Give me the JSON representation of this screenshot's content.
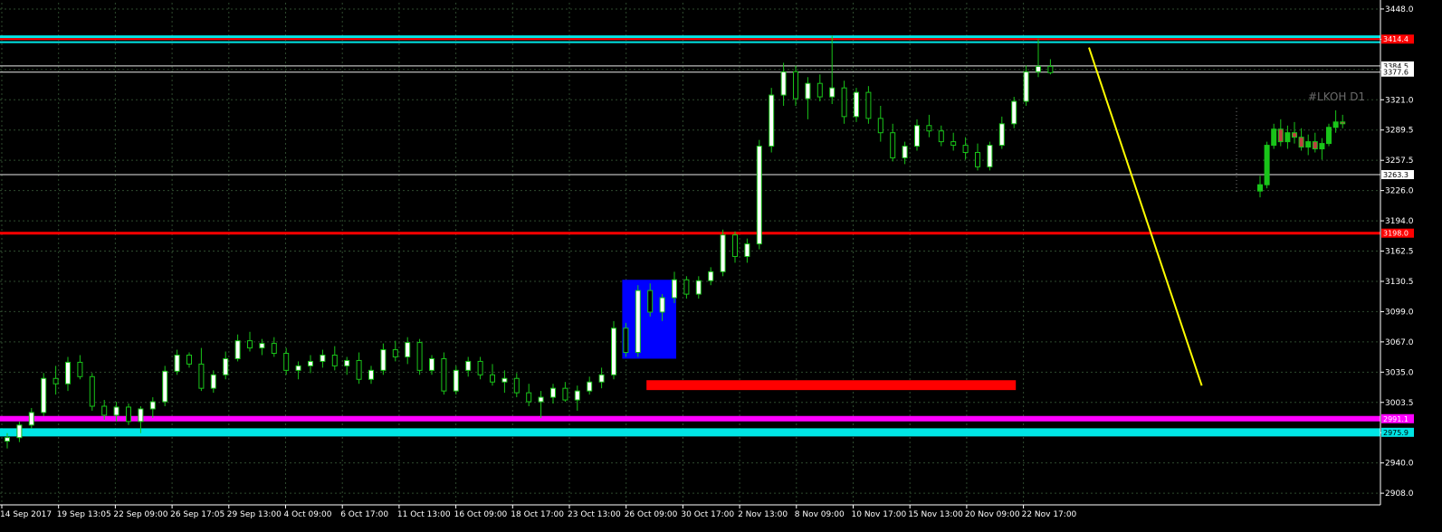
{
  "window": {
    "symbol_title": "#LKOH D1"
  },
  "colors": {
    "background": "#000000",
    "grid": "#2e4a2e",
    "axis": "#ffffff",
    "bull": "#ffffff",
    "bear": "#000000",
    "wick": "#19c419",
    "red": "#ff0000",
    "cyan": "#00e5e5",
    "magenta": "#ff00ff",
    "blue": "#0000ff",
    "yellow": "#ffff00",
    "white_line": "#e8e8e8",
    "mini_bull": "#19c419",
    "mini_bear": "#c04040"
  },
  "chart_data": {
    "type": "candlestick",
    "title": "#LKOH D1",
    "ylim": [
      2895.0,
      3455.0
    ],
    "y_ticks": [
      "3448.0",
      "3385.0",
      "3353.0",
      "3321.0",
      "3289.5",
      "3257.5",
      "3226.0",
      "3194.0",
      "3162.5",
      "3130.5",
      "3099.0",
      "3067.0",
      "3035.0",
      "3003.5",
      "2971.5",
      "2940.0",
      "2908.0"
    ],
    "x_ticks": [
      "14 Sep 2017",
      "19 Sep 13:05",
      "22 Sep 09:00",
      "26 Sep 17:05",
      "29 Sep 13:00",
      "4 Oct 09:00",
      "6 Oct 17:00",
      "11 Oct 13:00",
      "16 Oct 09:00",
      "18 Oct 17:00",
      "23 Oct 13:00",
      "26 Oct 09:00",
      "30 Oct 17:00",
      "2 Nov 13:00",
      "8 Nov 09:00",
      "10 Nov 17:00",
      "15 Nov 13:00",
      "20 Nov 09:00",
      "22 Nov 17:00"
    ],
    "price_labels": [
      {
        "value": 3414.4,
        "text": "3414.4",
        "style": "red"
      },
      {
        "value": 3384.5,
        "text": "3384.5",
        "style": "white"
      },
      {
        "value": 3377.6,
        "text": "3377.6",
        "style": "white"
      },
      {
        "value": 3263.3,
        "text": "3263.3",
        "style": "white"
      },
      {
        "value": 3198.0,
        "text": "3198.0",
        "style": "red"
      },
      {
        "value": 2991.1,
        "text": "2991.1",
        "style": "magenta"
      },
      {
        "value": 2975.9,
        "text": "2975.9",
        "style": "cyan"
      }
    ],
    "horizontal_lines": [
      {
        "value": 3417.0,
        "color": "cyan",
        "width": 3
      },
      {
        "value": 3414.4,
        "color": "red",
        "width": 2
      },
      {
        "value": 3411.0,
        "color": "cyan",
        "width": 2
      },
      {
        "value": 3384.5,
        "color": "white_line",
        "width": 1
      },
      {
        "value": 3377.6,
        "color": "white_line",
        "width": 1
      },
      {
        "value": 3263.3,
        "color": "white_line",
        "width": 1
      },
      {
        "value": 3198.0,
        "color": "red",
        "width": 3
      },
      {
        "value": 2991.1,
        "color": "magenta",
        "width": 6
      },
      {
        "value": 2975.9,
        "color": "cyan",
        "width": 9
      }
    ],
    "rectangles": [
      {
        "i0": 51,
        "i1": 55,
        "y0": 3058.0,
        "y1": 3146.0,
        "color": "blue"
      },
      {
        "i0": 53,
        "i1": 83,
        "y0": 3023.0,
        "y1": 3034.0,
        "color": "red"
      }
    ],
    "trendline": {
      "i0": 85,
      "y0": 3405.0,
      "i1": 94,
      "y1": 3028.0,
      "color": "yellow"
    },
    "candles": [
      [
        2966,
        2975,
        2958,
        2970
      ],
      [
        2970,
        2988,
        2965,
        2984
      ],
      [
        2984,
        3003,
        2980,
        2998
      ],
      [
        2998,
        3042,
        2994,
        3036
      ],
      [
        3036,
        3050,
        3018,
        3030
      ],
      [
        3030,
        3060,
        3022,
        3054
      ],
      [
        3054,
        3062,
        3035,
        3038
      ],
      [
        3038,
        3042,
        3000,
        3005
      ],
      [
        3005,
        3012,
        2990,
        2995
      ],
      [
        2995,
        3010,
        2988,
        3004
      ],
      [
        3004,
        3008,
        2984,
        2988
      ],
      [
        2988,
        3005,
        2975,
        3002
      ],
      [
        3002,
        3015,
        2992,
        3010
      ],
      [
        3010,
        3050,
        3005,
        3044
      ],
      [
        3044,
        3068,
        3040,
        3062
      ],
      [
        3062,
        3065,
        3048,
        3052
      ],
      [
        3052,
        3070,
        3022,
        3025
      ],
      [
        3025,
        3045,
        3020,
        3040
      ],
      [
        3040,
        3066,
        3035,
        3058
      ],
      [
        3058,
        3085,
        3055,
        3078
      ],
      [
        3078,
        3088,
        3066,
        3070
      ],
      [
        3070,
        3080,
        3062,
        3075
      ],
      [
        3075,
        3082,
        3060,
        3064
      ],
      [
        3064,
        3070,
        3040,
        3045
      ],
      [
        3045,
        3055,
        3035,
        3050
      ],
      [
        3050,
        3062,
        3042,
        3055
      ],
      [
        3055,
        3068,
        3048,
        3062
      ],
      [
        3062,
        3072,
        3045,
        3050
      ],
      [
        3050,
        3060,
        3040,
        3056
      ],
      [
        3056,
        3065,
        3030,
        3035
      ],
      [
        3035,
        3050,
        3030,
        3045
      ],
      [
        3045,
        3075,
        3040,
        3068
      ],
      [
        3068,
        3078,
        3055,
        3060
      ],
      [
        3060,
        3082,
        3052,
        3076
      ],
      [
        3076,
        3080,
        3040,
        3045
      ],
      [
        3045,
        3062,
        3040,
        3058
      ],
      [
        3058,
        3065,
        3018,
        3022
      ],
      [
        3022,
        3050,
        3018,
        3045
      ],
      [
        3045,
        3060,
        3038,
        3055
      ],
      [
        3055,
        3060,
        3035,
        3040
      ],
      [
        3040,
        3052,
        3028,
        3032
      ],
      [
        3032,
        3045,
        3020,
        3036
      ],
      [
        3036,
        3042,
        3015,
        3020
      ],
      [
        3020,
        3030,
        3005,
        3010
      ],
      [
        3010,
        3022,
        2992,
        3015
      ],
      [
        3015,
        3030,
        3008,
        3025
      ],
      [
        3025,
        3032,
        3010,
        3012
      ],
      [
        3012,
        3028,
        3000,
        3022
      ],
      [
        3022,
        3038,
        3018,
        3032
      ],
      [
        3032,
        3048,
        3025,
        3040
      ],
      [
        3040,
        3100,
        3035,
        3092
      ],
      [
        3092,
        3098,
        3060,
        3065
      ],
      [
        3065,
        3140,
        3060,
        3134
      ],
      [
        3134,
        3142,
        3105,
        3110
      ],
      [
        3110,
        3130,
        3100,
        3126
      ],
      [
        3126,
        3155,
        3120,
        3146
      ],
      [
        3146,
        3150,
        3125,
        3130
      ],
      [
        3130,
        3150,
        3125,
        3145
      ],
      [
        3145,
        3160,
        3140,
        3155
      ],
      [
        3155,
        3202,
        3150,
        3196
      ],
      [
        3196,
        3200,
        3165,
        3172
      ],
      [
        3172,
        3192,
        3165,
        3186
      ],
      [
        3186,
        3302,
        3180,
        3295
      ],
      [
        3295,
        3360,
        3288,
        3352
      ],
      [
        3352,
        3388,
        3340,
        3378
      ],
      [
        3378,
        3385,
        3340,
        3348
      ],
      [
        3348,
        3372,
        3325,
        3365
      ],
      [
        3365,
        3375,
        3345,
        3350
      ],
      [
        3350,
        3418,
        3342,
        3360
      ],
      [
        3360,
        3368,
        3320,
        3328
      ],
      [
        3328,
        3360,
        3322,
        3355
      ],
      [
        3355,
        3362,
        3320,
        3326
      ],
      [
        3326,
        3340,
        3300,
        3310
      ],
      [
        3310,
        3320,
        3278,
        3282
      ],
      [
        3282,
        3300,
        3275,
        3295
      ],
      [
        3295,
        3325,
        3290,
        3318
      ],
      [
        3318,
        3330,
        3305,
        3312
      ],
      [
        3312,
        3318,
        3295,
        3300
      ],
      [
        3300,
        3310,
        3290,
        3296
      ],
      [
        3296,
        3305,
        3280,
        3288
      ],
      [
        3288,
        3298,
        3268,
        3272
      ],
      [
        3272,
        3300,
        3268,
        3296
      ],
      [
        3296,
        3328,
        3292,
        3320
      ],
      [
        3320,
        3350,
        3315,
        3345
      ],
      [
        3345,
        3385,
        3340,
        3378
      ],
      [
        3378,
        3415,
        3372,
        3384
      ],
      [
        3384,
        3392,
        3375,
        3377
      ]
    ],
    "inset_chart": {
      "title": "#LKOH D1",
      "candles": [
        [
          3245,
          3262,
          3238,
          3252
        ],
        [
          3252,
          3300,
          3248,
          3296
        ],
        [
          3296,
          3320,
          3292,
          3314
        ],
        [
          3314,
          3325,
          3295,
          3300
        ],
        [
          3300,
          3318,
          3292,
          3310
        ],
        [
          3310,
          3322,
          3298,
          3305
        ],
        [
          3305,
          3315,
          3290,
          3294
        ],
        [
          3294,
          3308,
          3285,
          3300
        ],
        [
          3300,
          3310,
          3288,
          3292
        ],
        [
          3292,
          3304,
          3280,
          3298
        ],
        [
          3298,
          3320,
          3295,
          3316
        ],
        [
          3316,
          3335,
          3310,
          3322
        ],
        [
          3322,
          3330,
          3315,
          3320
        ]
      ]
    }
  }
}
